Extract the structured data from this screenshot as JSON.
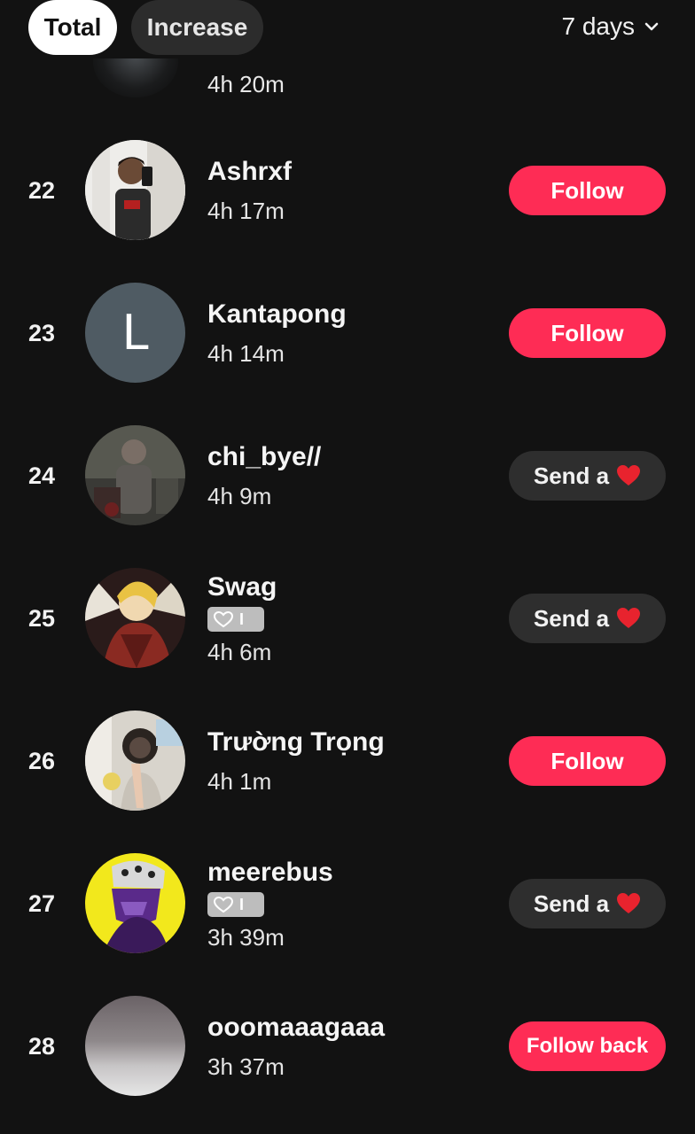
{
  "header": {
    "tab_total": "Total",
    "tab_increase": "Increase",
    "range_label": "7 days",
    "range_icon": "chevron-down-icon"
  },
  "partial_row": {
    "time": "4h 20m"
  },
  "rows": [
    {
      "rank": "22",
      "name": "Ashrxf",
      "time": "4h 17m",
      "action": "Follow"
    },
    {
      "rank": "23",
      "name": "Kantapong",
      "time": "4h 14m",
      "action": "Follow",
      "avatar_letter": "L"
    },
    {
      "rank": "24",
      "name": "chi_bye//",
      "time": "4h 9m",
      "action": "Send a"
    },
    {
      "rank": "25",
      "name": "Swag",
      "badge_level": "I",
      "time": "4h 6m",
      "action": "Send a"
    },
    {
      "rank": "26",
      "name": "Trường Trọng",
      "time": "4h 1m",
      "action": "Follow"
    },
    {
      "rank": "27",
      "name": "meerebus",
      "badge_level": "I",
      "time": "3h 39m",
      "action": "Send a"
    },
    {
      "rank": "28",
      "name": "ooomaaagaaa",
      "time": "3h 37m",
      "action": "Follow back"
    }
  ],
  "colors": {
    "background": "#121212",
    "follow_button": "#fe2c55",
    "send_button": "#2e2e2e",
    "heart": "#e8232e"
  }
}
